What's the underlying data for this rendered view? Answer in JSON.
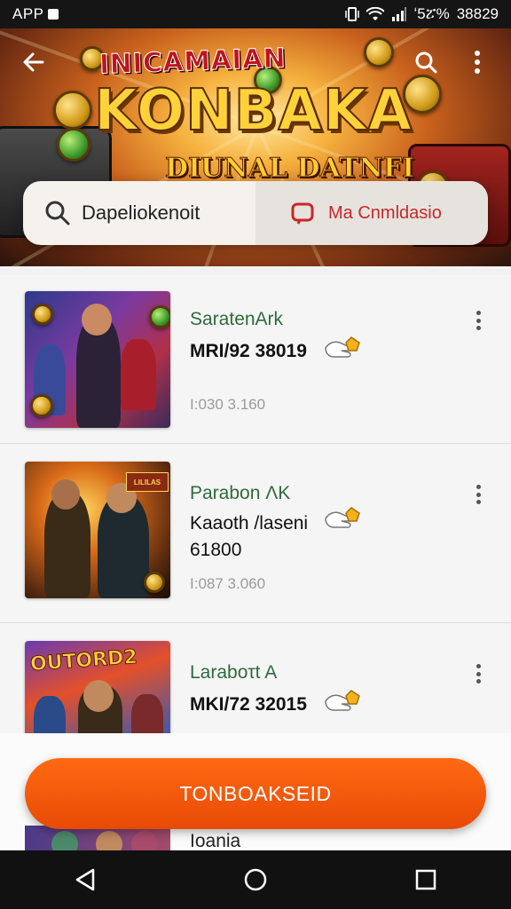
{
  "status_bar": {
    "app_label": "APP",
    "battery_text": "ʻ5ፘ%",
    "time": "38829"
  },
  "hero": {
    "title_top": "INICAMAIAN",
    "title_main": "KONBAKA",
    "title_sub": "DIUNAL DATNFI"
  },
  "search": {
    "placeholder": "Dapeliokenoit",
    "category_label": "Ma Cnmldasio"
  },
  "colors": {
    "accent_orange": "#f05a0a",
    "category_red": "#c62828",
    "title_green": "#2f6b3a"
  },
  "items": [
    {
      "title": "SaratenArk",
      "line1": "MRI/92 38019",
      "meta": "I:030 3.160"
    },
    {
      "title": "Parabon ɅK",
      "line1": "Kaaoth /laseni",
      "line2": "61800",
      "meta": "I:087 3.060"
    },
    {
      "title": "Laraboτt A",
      "line1": "MKI/72 32015",
      "meta": ""
    }
  ],
  "thumb_text": {
    "item2_badge": "LILILAS",
    "item3_logo": "OUTORD2"
  },
  "peek_item": {
    "title": "Ioania"
  },
  "cta": {
    "label": "TONBOAKSEID"
  },
  "icons": {
    "back": "arrow-left",
    "search": "magnifier",
    "more": "kebab",
    "category": "rounded-square",
    "reaction": "hand-coin",
    "nav_back": "triangle",
    "nav_home": "circle",
    "nav_recents": "square"
  }
}
